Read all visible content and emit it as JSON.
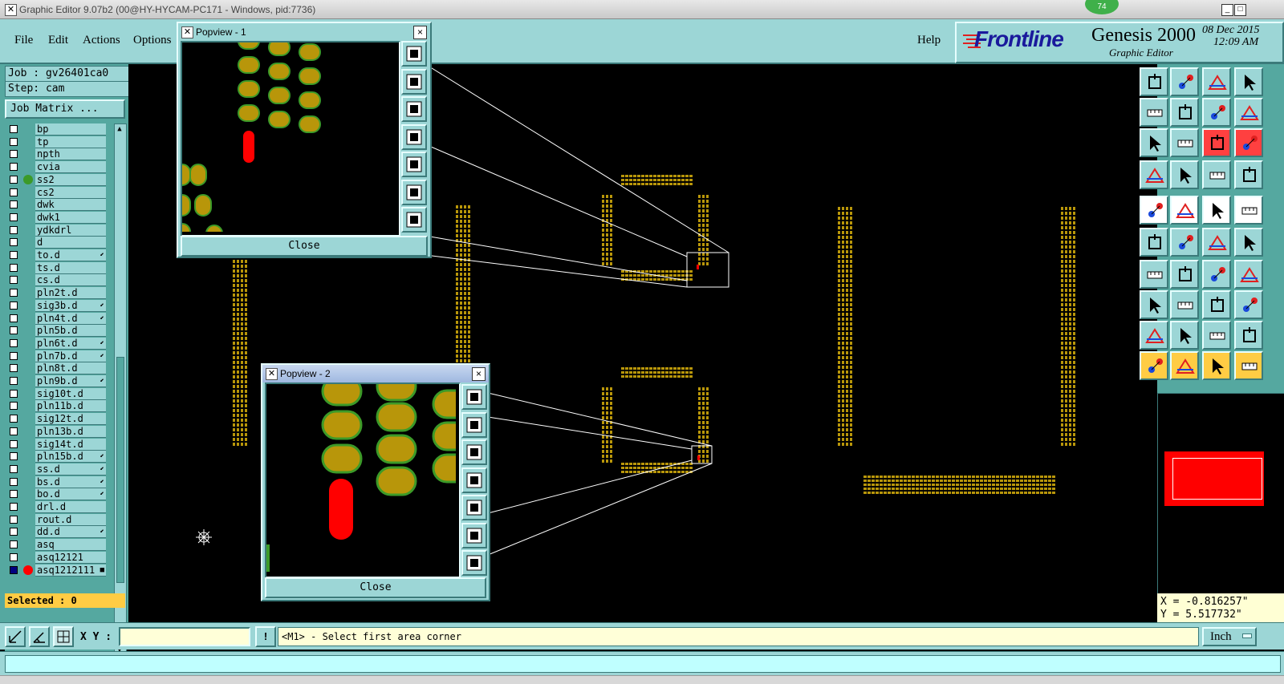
{
  "window": {
    "title": "Graphic Editor 9.07b2 (00@HY-HYCAM-PC171 - Windows, pid:7736)",
    "badge": "74",
    "minimize": "_",
    "maximize": "□"
  },
  "menu": {
    "items": [
      "File",
      "Edit",
      "Actions",
      "Options"
    ],
    "help": "Help"
  },
  "brand": {
    "logo": "Frontline",
    "product": "Genesis 2000",
    "subtitle": "Graphic Editor",
    "date": "08 Dec 2015",
    "time": "12:09 AM"
  },
  "job": {
    "job_label": "Job : gv26401ca0",
    "step_label": "Step: cam",
    "matrix_button": "Job Matrix ..."
  },
  "layers": [
    {
      "name": "bp",
      "dot": "",
      "flag": ""
    },
    {
      "name": "tp",
      "dot": "",
      "flag": ""
    },
    {
      "name": "npth",
      "dot": "",
      "flag": ""
    },
    {
      "name": "cvia",
      "dot": "",
      "flag": ""
    },
    {
      "name": "ss2",
      "dot": "#3c9a28",
      "flag": ""
    },
    {
      "name": "cs2",
      "dot": "",
      "flag": ""
    },
    {
      "name": "dwk",
      "dot": "",
      "flag": ""
    },
    {
      "name": "dwk1",
      "dot": "",
      "flag": ""
    },
    {
      "name": "ydkdrl",
      "dot": "",
      "flag": ""
    },
    {
      "name": "d",
      "dot": "",
      "flag": ""
    },
    {
      "name": "to.d",
      "dot": "",
      "flag": "⬋"
    },
    {
      "name": "ts.d",
      "dot": "",
      "flag": ""
    },
    {
      "name": "cs.d",
      "dot": "",
      "flag": ""
    },
    {
      "name": "pln2t.d",
      "dot": "",
      "flag": ""
    },
    {
      "name": "sig3b.d",
      "dot": "",
      "flag": "⬋"
    },
    {
      "name": "pln4t.d",
      "dot": "",
      "flag": "⬋"
    },
    {
      "name": "pln5b.d",
      "dot": "",
      "flag": ""
    },
    {
      "name": "pln6t.d",
      "dot": "",
      "flag": "⬋"
    },
    {
      "name": "pln7b.d",
      "dot": "",
      "flag": "⬋"
    },
    {
      "name": "pln8t.d",
      "dot": "",
      "flag": ""
    },
    {
      "name": "pln9b.d",
      "dot": "",
      "flag": "⬋"
    },
    {
      "name": "sig10t.d",
      "dot": "",
      "flag": ""
    },
    {
      "name": "pln11b.d",
      "dot": "",
      "flag": ""
    },
    {
      "name": "sig12t.d",
      "dot": "",
      "flag": ""
    },
    {
      "name": "pln13b.d",
      "dot": "",
      "flag": ""
    },
    {
      "name": "sig14t.d",
      "dot": "",
      "flag": ""
    },
    {
      "name": "pln15b.d",
      "dot": "",
      "flag": "⬋"
    },
    {
      "name": "ss.d",
      "dot": "",
      "flag": "⬋"
    },
    {
      "name": "bs.d",
      "dot": "",
      "flag": "⬋"
    },
    {
      "name": "bo.d",
      "dot": "",
      "flag": "⬋"
    },
    {
      "name": "drl.d",
      "dot": "",
      "flag": ""
    },
    {
      "name": "rout.d",
      "dot": "",
      "flag": ""
    },
    {
      "name": "dd.d",
      "dot": "",
      "flag": "⬋"
    },
    {
      "name": "asq",
      "dot": "",
      "flag": ""
    },
    {
      "name": "asq12121",
      "dot": "",
      "flag": ""
    },
    {
      "name": "asq1212111",
      "dot": "#ff0000",
      "flag": "■",
      "active": true
    }
  ],
  "selected": "Selected : 0",
  "command": {
    "xy_label": "X Y :",
    "xy_value": "",
    "alert": "!",
    "prompt": "<M1> - Select first area corner",
    "units": "Inch"
  },
  "coords": {
    "x": "X = -0.816257\"",
    "y": "Y = 5.517732\""
  },
  "popup1": {
    "title": "Popview - 1",
    "close_label": "Close",
    "close_x": "×"
  },
  "popup2": {
    "title": "Popview - 2",
    "close_label": "Close",
    "close_x": "×"
  },
  "colors": {
    "teal": "#9cd6d6",
    "pad_fill": "#b8960a",
    "pad_outline": "#3c9a28",
    "highlight": "#ff0000",
    "brand_red": "#e02020",
    "brand_blue": "#1a1a9c"
  }
}
